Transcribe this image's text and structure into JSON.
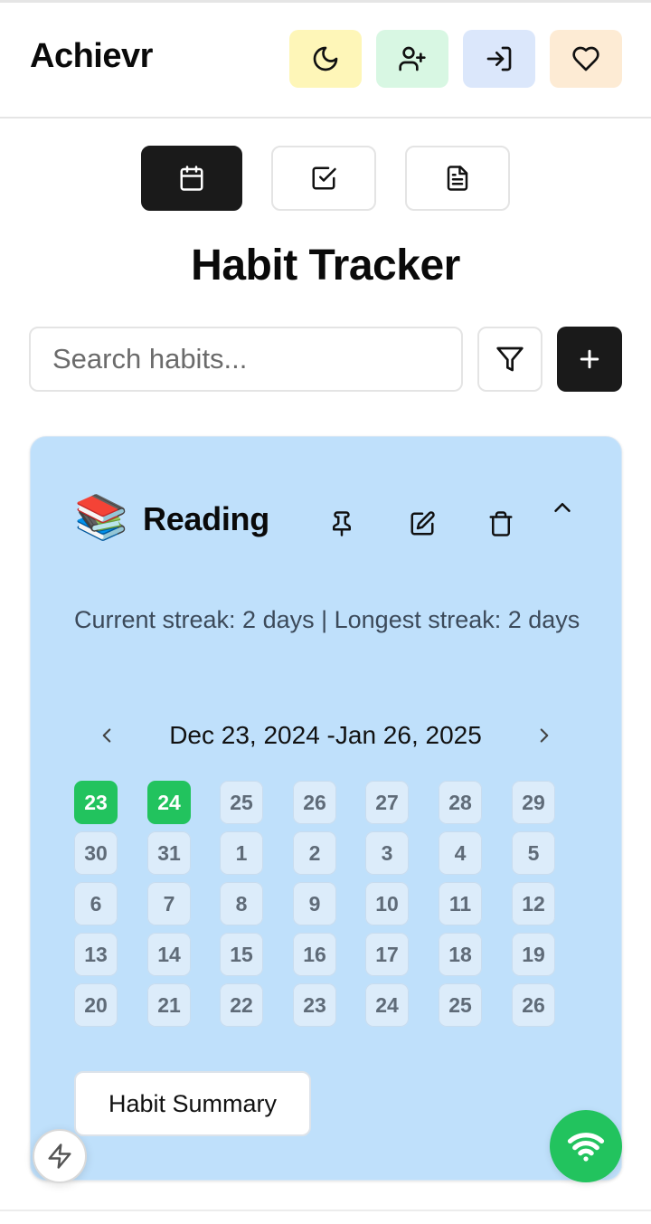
{
  "app": {
    "brand": "Achievr",
    "header_buttons": [
      {
        "icon": "moon-icon",
        "color": "#fef6b8"
      },
      {
        "icon": "user-plus-icon",
        "color": "#d8f7e3"
      },
      {
        "icon": "log-in-icon",
        "color": "#dbe7fb"
      },
      {
        "icon": "heart-icon",
        "color": "#fdebd4"
      }
    ]
  },
  "view_tabs": [
    {
      "icon": "calendar-icon",
      "active": true
    },
    {
      "icon": "checkbox-icon",
      "active": false
    },
    {
      "icon": "file-text-icon",
      "active": false
    }
  ],
  "page": {
    "title": "Habit Tracker",
    "search_placeholder": "Search habits...",
    "search_value": ""
  },
  "habit": {
    "emoji": "📚",
    "name": "Reading",
    "card_color": "#bfe0fb",
    "streak_text": "Current streak: 2 days | Longest streak: 2 days",
    "range_label": "Dec 23, 2024 -Jan 26, 2025",
    "days": [
      {
        "label": "23",
        "done": true
      },
      {
        "label": "24",
        "done": true
      },
      {
        "label": "25",
        "done": false
      },
      {
        "label": "26",
        "done": false
      },
      {
        "label": "27",
        "done": false
      },
      {
        "label": "28",
        "done": false
      },
      {
        "label": "29",
        "done": false
      },
      {
        "label": "30",
        "done": false
      },
      {
        "label": "31",
        "done": false
      },
      {
        "label": "1",
        "done": false
      },
      {
        "label": "2",
        "done": false
      },
      {
        "label": "3",
        "done": false
      },
      {
        "label": "4",
        "done": false
      },
      {
        "label": "5",
        "done": false
      },
      {
        "label": "6",
        "done": false
      },
      {
        "label": "7",
        "done": false
      },
      {
        "label": "8",
        "done": false
      },
      {
        "label": "9",
        "done": false
      },
      {
        "label": "10",
        "done": false
      },
      {
        "label": "11",
        "done": false
      },
      {
        "label": "12",
        "done": false
      },
      {
        "label": "13",
        "done": false
      },
      {
        "label": "14",
        "done": false
      },
      {
        "label": "15",
        "done": false
      },
      {
        "label": "16",
        "done": false
      },
      {
        "label": "17",
        "done": false
      },
      {
        "label": "18",
        "done": false
      },
      {
        "label": "19",
        "done": false
      },
      {
        "label": "20",
        "done": false
      },
      {
        "label": "21",
        "done": false
      },
      {
        "label": "22",
        "done": false
      },
      {
        "label": "23",
        "done": false
      },
      {
        "label": "24",
        "done": false
      },
      {
        "label": "25",
        "done": false
      },
      {
        "label": "26",
        "done": false
      }
    ],
    "done_color": "#22c35e",
    "summary_label": "Habit Summary"
  },
  "floating": {
    "left_icon": "zap-icon",
    "right_icon": "wifi-icon",
    "right_color": "#22c35e"
  }
}
